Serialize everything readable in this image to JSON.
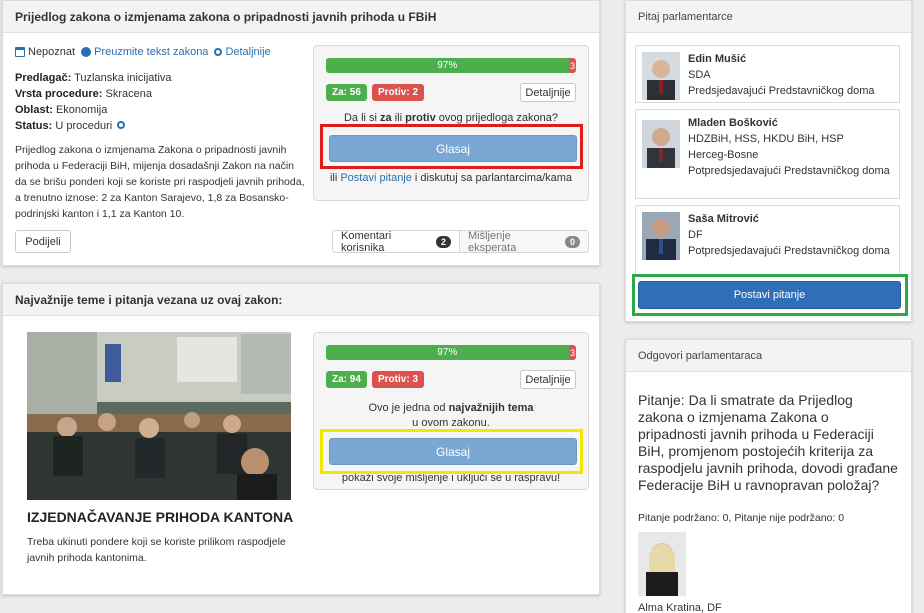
{
  "law": {
    "title": "Prijedlog zakona o izmjenama zakona o pripadnosti javnih prihoda u FBiH",
    "meta_unknown": "Nepoznat",
    "download_link": "Preuzmite tekst zakona",
    "details_link": "Detaljnije",
    "proposer_label": "Predlagač:",
    "proposer_value": "Tuzlanska inicijativa",
    "procedure_label": "Vrsta procedure:",
    "procedure_value": "Skracena",
    "area_label": "Oblast:",
    "area_value": "Ekonomija",
    "status_label": "Status:",
    "status_value": "U proceduri",
    "description": "Prijedlog zakona o izmjenama Zakona o pripadnosti javnih prihoda u Federaciji BiH, mijenja dosadašnji Zakon na način da se brišu ponderi koji se koriste pri raspodjeli javnih prihoda, a trenutno iznose: 2 za Kanton Sarajevo, 1,8 za Bosansko-podrinjski kanton i 1,1 za Kanton 10.",
    "share_button": "Podijeli",
    "tab_comments": "Komentari korisnika",
    "tab_comments_count": "2",
    "tab_experts": "Mišljenje eksperata",
    "tab_experts_count": "0"
  },
  "vote1": {
    "yes_percent": 97,
    "yes_label": "97%",
    "no_label": "3",
    "za": "Za: 56",
    "protiv": "Protiv: 2",
    "details_button": "Detaljnije",
    "question_pre": "Da li si ",
    "question_za": "za",
    "question_mid": " ili ",
    "question_protiv": "protiv",
    "question_post": " ovog prijedloga zakona?",
    "vote_button": "Glasaj",
    "footer_pre": "ili ",
    "footer_link": "Postavi pitanje",
    "footer_post": " i diskutuj sa parlantarcima/kama"
  },
  "topics": {
    "title": "Najvažnije teme i pitanja vezana uz ovaj zakon:",
    "topic_title": "IZJEDNAČAVANJE PRIHODA KANTONA",
    "topic_desc": "Treba ukinuti pondere koji se koriste prilikom raspodjele javnih prihoda kantonima."
  },
  "vote2": {
    "yes_percent": 97,
    "yes_label": "97%",
    "no_label": "3",
    "za": "Za: 94",
    "protiv": "Protiv: 3",
    "details_button": "Detaljnije",
    "text_pre": "Ovo je jedna od ",
    "text_bold": "najvažnijih tema",
    "text_post": "u ovom zakonu.",
    "vote_button": "Glasaj",
    "footer": "pokaži svoje mišljenje i uključi se u raspravu!"
  },
  "ask": {
    "title": "Pitaj parlamentarce",
    "mps": [
      {
        "name": "Edin Mušić",
        "line1": "SDA",
        "line2": "Predsjedavajući Predstavničkog doma",
        "line3": ""
      },
      {
        "name": "Mladen Bošković",
        "line1": "HDZBiH, HSS, HKDU BiH, HSP",
        "line2": "Herceg-Bosne",
        "line3": "Potpredsjedavajući Predstavničkog doma"
      },
      {
        "name": "Saša Mitrović",
        "line1": "DF",
        "line2": "Potpredsjedavajući Predstavničkog doma",
        "line3": ""
      }
    ],
    "ask_button": "Postavi pitanje"
  },
  "answers": {
    "title": "Odgovori parlamentaraca",
    "question": "Pitanje: Da li smatrate da Prijedlog zakona o izmjenama Zakona o pripadnosti javnih prihoda u Federaciji BiH, promjenom postojećih kriterija za raspodjelu javnih prihoda, dovodi građane Federacije BiH u ravnopravan položaj?",
    "support": "Pitanje podržano: 0, Pitanje nije podržano: 0",
    "mp_name": "Alma Kratina, DF"
  },
  "colors": {
    "highlight_red": "#e01b1b",
    "highlight_yellow": "#f0e800",
    "highlight_green": "#2ba84a",
    "primary_button": "#2f6fb8",
    "vote_button": "#7aa7d4"
  }
}
